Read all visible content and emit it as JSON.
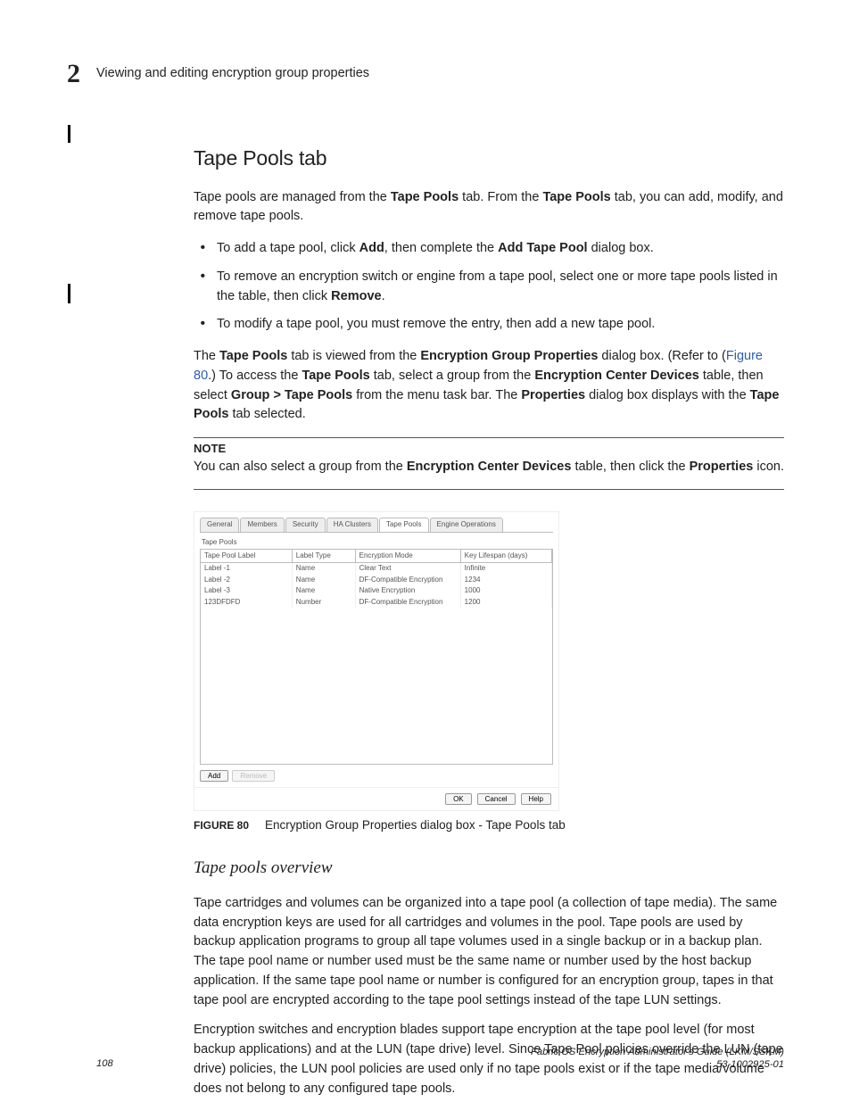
{
  "header": {
    "chapter_number": "2",
    "running_head": "Viewing and editing encryption group properties"
  },
  "section": {
    "title": "Tape Pools tab",
    "intro_pre": "Tape pools are managed from the ",
    "intro_b1": "Tape Pools",
    "intro_mid1": " tab. From the ",
    "intro_b2": "Tape Pools",
    "intro_post": " tab, you can add, modify, and remove tape pools.",
    "bullets": {
      "b1_pre": "To add a tape pool, click ",
      "b1_b1": "Add",
      "b1_mid1": ", then complete the ",
      "b1_b2": "Add Tape Pool",
      "b1_post": " dialog box.",
      "b2_pre": "To remove an encryption switch or engine from a tape pool, select one or more tape pools listed in the table, then click ",
      "b2_b1": "Remove",
      "b2_post": ".",
      "b3": "To modify a tape pool, you must remove the entry, then add a new tape pool."
    },
    "access": {
      "pre": "The ",
      "b1": "Tape Pools",
      "t1": " tab is viewed from the ",
      "b2": "Encryption Group Properties",
      "t2": " dialog box. (Refer to (",
      "link": "Figure 80",
      "t3": ".) To access the ",
      "b3": "Tape Pools",
      "t4": " tab, select a group from the ",
      "b4": "Encryption Center Devices",
      "t5": " table, then select ",
      "b5": "Group > Tape Pools",
      "t6": " from the menu task bar. The ",
      "b6": "Properties",
      "t7": " dialog box displays with the ",
      "b7": "Tape Pools",
      "t8": " tab selected."
    },
    "note": {
      "head": "NOTE",
      "pre": "You can also select a group from the ",
      "b1": "Encryption Center Devices",
      "mid": " table, then click the ",
      "b2": "Properties",
      "post": " icon."
    }
  },
  "dialog": {
    "tabs": [
      "General",
      "Members",
      "Security",
      "HA Clusters",
      "Tape Pools",
      "Engine Operations"
    ],
    "panel_label": "Tape Pools",
    "columns": [
      "Tape Pool Label",
      "Label Type",
      "Encryption Mode",
      "Key Lifespan (days)"
    ],
    "rows": [
      {
        "c0": "Label -1",
        "c1": "Name",
        "c2": "Clear Text",
        "c3": "Infinite"
      },
      {
        "c0": "Label -2",
        "c1": "Name",
        "c2": "DF-Compatible Encryption",
        "c3": "1234"
      },
      {
        "c0": "Label -3",
        "c1": "Name",
        "c2": "Native Encryption",
        "c3": "1000"
      },
      {
        "c0": "123DFDFD",
        "c1": "Number",
        "c2": "DF-Compatible Encryption",
        "c3": "1200"
      }
    ],
    "btn_add": "Add",
    "btn_remove": "Remove",
    "btn_ok": "OK",
    "btn_cancel": "Cancel",
    "btn_help": "Help"
  },
  "figure": {
    "label": "FIGURE 80",
    "caption": "Encryption Group Properties dialog box - Tape Pools tab"
  },
  "overview": {
    "title": "Tape pools overview",
    "p1": "Tape cartridges and volumes can be organized into a tape pool (a collection of tape media). The same data encryption keys are used for all cartridges and volumes in the pool. Tape pools are used by backup application programs to group all tape volumes used in a single backup or in a backup plan. The tape pool name or number used must be the same name or number used by the host backup application. If the same tape pool name or number is configured for an encryption group, tapes in that tape pool are encrypted according to the tape pool settings instead of the tape LUN settings.",
    "p2": "Encryption switches and encryption blades support tape encryption at the tape pool level (for most backup applications) and at the LUN (tape drive) level. Since Tape Pool policies override the LUN (tape drive) policies, the LUN pool policies are used only if no tape pools exist or if the tape media/volume does not belong to any configured tape pools."
  },
  "footer": {
    "page": "108",
    "doc_title": "Fabric OS Encryption Administrator's Guide  (LKM/SSKM)",
    "doc_rev": "53-1002925-01"
  }
}
